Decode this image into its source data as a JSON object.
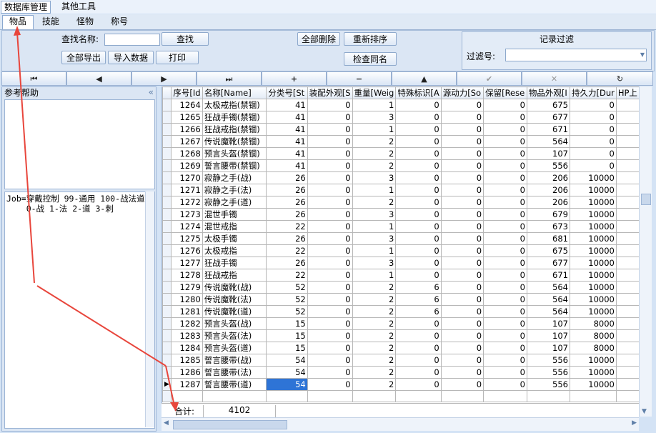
{
  "menu": {
    "items": [
      "数据库管理",
      "其他工具"
    ]
  },
  "tabs": [
    "物品",
    "技能",
    "怪物",
    "称号"
  ],
  "search": {
    "label": "查找名称:",
    "value": "",
    "find_button": "查找"
  },
  "buttons": {
    "export_all": "全部导出",
    "import": "导入数据",
    "print": "打印",
    "delete_all": "全部删除",
    "reorder": "重新排序",
    "check_dup": "检查同名"
  },
  "filter": {
    "title": "记录过滤",
    "label": "过滤号:",
    "value": ""
  },
  "nav": {
    "first": "⏮",
    "prev": "◀",
    "next": "▶",
    "last": "⏭",
    "add": "+",
    "remove": "−",
    "up": "▲",
    "post": "✔",
    "cancel": "✕",
    "refresh": "↻"
  },
  "help": {
    "title": "参考帮助",
    "collapse": "«",
    "job_text": "Job=穿戴控制 99-通用 100-战法道\n    0-战 1-法 2-道 3-刺"
  },
  "grid": {
    "headers": [
      "序号[Id",
      "名称[Name]",
      "分类号[St",
      "装配外观[S",
      "重量[Weig",
      "特殊标识[A",
      "源动力[So",
      "保留[Rese",
      "物品外观[I",
      "持久力[Dur",
      "HP上"
    ],
    "rows": [
      [
        "1264",
        "太极戒指(禁锢)",
        "41",
        "0",
        "1",
        "0",
        "0",
        "0",
        "675",
        "0",
        ""
      ],
      [
        "1265",
        "狂战手镯(禁锢)",
        "41",
        "0",
        "3",
        "0",
        "0",
        "0",
        "677",
        "0",
        ""
      ],
      [
        "1266",
        "狂战戒指(禁锢)",
        "41",
        "0",
        "1",
        "0",
        "0",
        "0",
        "671",
        "0",
        ""
      ],
      [
        "1267",
        "传说魔靴(禁锢)",
        "41",
        "0",
        "2",
        "0",
        "0",
        "0",
        "564",
        "0",
        ""
      ],
      [
        "1268",
        "预言头盔(禁锢)",
        "41",
        "0",
        "2",
        "0",
        "0",
        "0",
        "107",
        "0",
        ""
      ],
      [
        "1269",
        "誓言腰带(禁锢)",
        "41",
        "0",
        "2",
        "0",
        "0",
        "0",
        "556",
        "0",
        ""
      ],
      [
        "1270",
        "寂静之手(战)",
        "26",
        "0",
        "3",
        "0",
        "0",
        "0",
        "206",
        "10000",
        ""
      ],
      [
        "1271",
        "寂静之手(法)",
        "26",
        "0",
        "1",
        "0",
        "0",
        "0",
        "206",
        "10000",
        ""
      ],
      [
        "1272",
        "寂静之手(道)",
        "26",
        "0",
        "2",
        "0",
        "0",
        "0",
        "206",
        "10000",
        ""
      ],
      [
        "1273",
        "混世手镯",
        "26",
        "0",
        "3",
        "0",
        "0",
        "0",
        "679",
        "10000",
        ""
      ],
      [
        "1274",
        "混世戒指",
        "22",
        "0",
        "1",
        "0",
        "0",
        "0",
        "673",
        "10000",
        ""
      ],
      [
        "1275",
        "太极手镯",
        "26",
        "0",
        "3",
        "0",
        "0",
        "0",
        "681",
        "10000",
        ""
      ],
      [
        "1276",
        "太极戒指",
        "22",
        "0",
        "1",
        "0",
        "0",
        "0",
        "675",
        "10000",
        ""
      ],
      [
        "1277",
        "狂战手镯",
        "26",
        "0",
        "3",
        "0",
        "0",
        "0",
        "677",
        "10000",
        ""
      ],
      [
        "1278",
        "狂战戒指",
        "22",
        "0",
        "1",
        "0",
        "0",
        "0",
        "671",
        "10000",
        ""
      ],
      [
        "1279",
        "传说魔靴(战)",
        "52",
        "0",
        "2",
        "6",
        "0",
        "0",
        "564",
        "10000",
        ""
      ],
      [
        "1280",
        "传说魔靴(法)",
        "52",
        "0",
        "2",
        "6",
        "0",
        "0",
        "564",
        "10000",
        ""
      ],
      [
        "1281",
        "传说魔靴(道)",
        "52",
        "0",
        "2",
        "6",
        "0",
        "0",
        "564",
        "10000",
        ""
      ],
      [
        "1282",
        "预言头盔(战)",
        "15",
        "0",
        "2",
        "0",
        "0",
        "0",
        "107",
        "8000",
        ""
      ],
      [
        "1283",
        "预言头盔(法)",
        "15",
        "0",
        "2",
        "0",
        "0",
        "0",
        "107",
        "8000",
        ""
      ],
      [
        "1284",
        "预言头盔(道)",
        "15",
        "0",
        "2",
        "0",
        "0",
        "0",
        "107",
        "8000",
        ""
      ],
      [
        "1285",
        "誓言腰带(战)",
        "54",
        "0",
        "2",
        "0",
        "0",
        "0",
        "556",
        "10000",
        ""
      ],
      [
        "1286",
        "誓言腰带(法)",
        "54",
        "0",
        "2",
        "0",
        "0",
        "0",
        "556",
        "10000",
        ""
      ],
      [
        "1287",
        "誓言腰带(道)",
        "54",
        "0",
        "2",
        "0",
        "0",
        "0",
        "556",
        "10000",
        ""
      ]
    ],
    "selected_row": 23,
    "total_label": "合计:",
    "total_value": "4102"
  },
  "colors": {
    "selection": "#2e74d6",
    "arrow": "#e8463c"
  }
}
